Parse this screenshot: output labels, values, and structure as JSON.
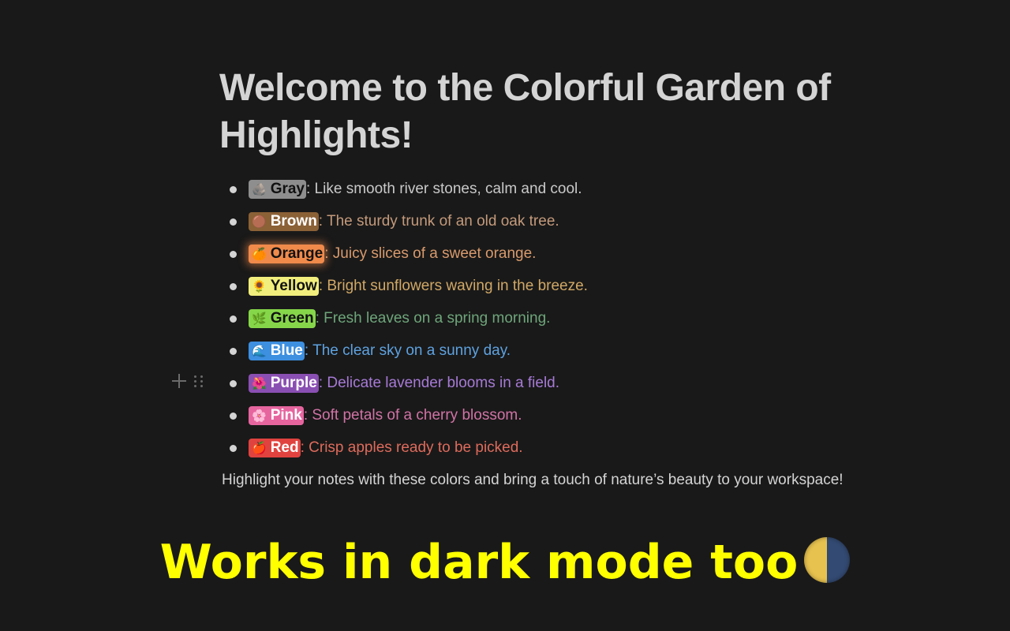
{
  "page": {
    "title": "Welcome to the Colorful Garden of Highlights!",
    "footer": "Highlight your notes with these colors and bring a touch of nature’s beauty to your workspace!",
    "banner": "Works in dark mode too",
    "banner_icon": "moon-icon"
  },
  "items": [
    {
      "label": "Gray",
      "emoji": "🪨",
      "icon": "rock-icon",
      "desc": ": Like smooth river stones, calm and cool.",
      "chip_bg": "#8e8e8e",
      "chip_fg": "#111111",
      "text_color": "#c9c9c9"
    },
    {
      "label": "Brown",
      "emoji": "🟤",
      "icon": "chestnut-icon",
      "desc": ": The sturdy trunk of an old oak tree.",
      "chip_bg": "#8b6136",
      "chip_fg": "#ffffff",
      "text_color": "#c49a7b"
    },
    {
      "label": "Orange",
      "emoji": "🍊",
      "icon": "orange-icon",
      "desc": ": Juicy slices of a sweet orange.",
      "chip_bg": "#f08a4b",
      "chip_fg": "#111111",
      "text_color": "#d99a6c"
    },
    {
      "label": "Yellow",
      "emoji": "🌻",
      "icon": "sunflower-icon",
      "desc": ": Bright sunflowers waving in the breeze.",
      "chip_bg": "#f1ee7d",
      "chip_fg": "#111111",
      "text_color": "#d1a866"
    },
    {
      "label": "Green",
      "emoji": "🌿",
      "icon": "leaf-icon",
      "desc": ": Fresh leaves on a spring morning.",
      "chip_bg": "#86d64a",
      "chip_fg": "#111111",
      "text_color": "#6ea57a"
    },
    {
      "label": "Blue",
      "emoji": "🌊",
      "icon": "wave-icon",
      "desc": ": The clear sky on a sunny day.",
      "chip_bg": "#3d8fe0",
      "chip_fg": "#ffffff",
      "text_color": "#5ea2e0"
    },
    {
      "label": "Purple",
      "emoji": "🌺",
      "icon": "lavender-icon",
      "desc": ": Delicate lavender blooms in a field.",
      "chip_bg": "#8a4fb2",
      "chip_fg": "#ffffff",
      "text_color": "#a77ad6"
    },
    {
      "label": "Pink",
      "emoji": "🌸",
      "icon": "cherry-blossom-icon",
      "desc": ": Soft petals of a cherry blossom.",
      "chip_bg": "#e6659f",
      "chip_fg": "#ffffff",
      "text_color": "#d173a5"
    },
    {
      "label": "Red",
      "emoji": "🍎",
      "icon": "apple-icon",
      "desc": ": Crisp apples ready to be picked.",
      "chip_bg": "#e0433f",
      "chip_fg": "#ffffff",
      "text_color": "#de6b5c"
    }
  ]
}
